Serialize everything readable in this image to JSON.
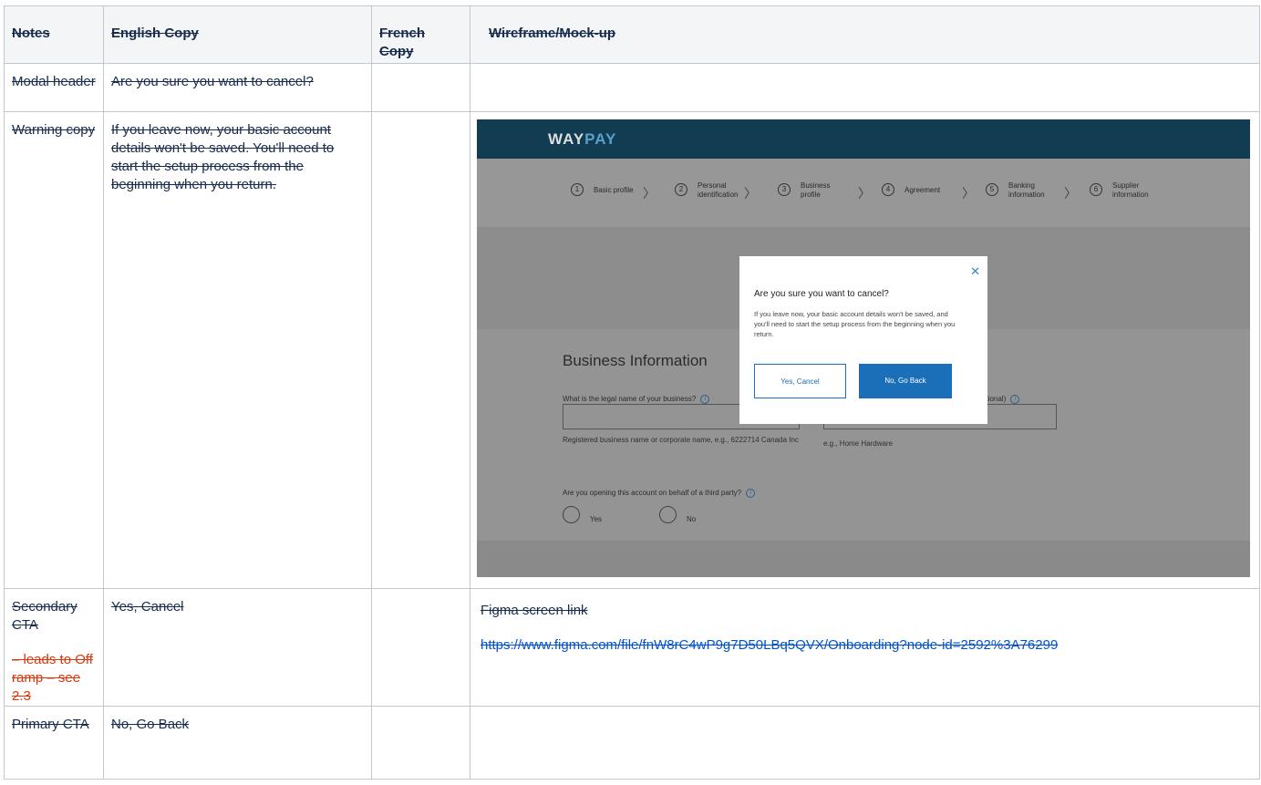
{
  "table": {
    "headers": {
      "notes": "Notes",
      "english": "English Copy",
      "french": "French Copy",
      "mock": "Wireframe/Mock-up"
    },
    "rows": [
      {
        "notes": "Modal header",
        "english": "Are you sure you want to cancel?",
        "french": ""
      },
      {
        "notes": "Warning copy",
        "english": "If you leave now, your basic account details won't be saved. You'll need to start the setup process from the beginning when you return.",
        "french": ""
      },
      {
        "notes": "Secondary CTA",
        "notes_extra": "– leads to Off ramp – see 2.3",
        "english": "Yes, Cancel",
        "french": "",
        "mock_label": "Figma screen link",
        "mock_link": "https://www.figma.com/file/fnW8rC4wP9g7D50LBq5QVX/Onboarding?node-id=2592%3A76299"
      },
      {
        "notes": "Primary CTA",
        "english": "No, Go Back",
        "french": ""
      }
    ]
  },
  "mockup": {
    "logo_way": "WAY",
    "logo_pay": "PAY",
    "steps": [
      {
        "num": "1",
        "label": "Basic profile"
      },
      {
        "num": "2",
        "label": "Personal identification"
      },
      {
        "num": "3",
        "label": "Business profile"
      },
      {
        "num": "4",
        "label": "Agreement"
      },
      {
        "num": "5",
        "label": "Banking information"
      },
      {
        "num": "6",
        "label": "Supplier information"
      }
    ],
    "form": {
      "title": "Business Information",
      "q1": "What is the legal name of your business?",
      "q2": "otional)",
      "help1": "Registered business name or corporate name,  e.g., 6222714 Canada Inc",
      "help2": "e.g., Home Hardware",
      "q3": "Are you opening this account on behalf of a third party?",
      "yes": "Yes",
      "no": "No",
      "info_glyph": "i"
    },
    "modal": {
      "close_glyph": "✕",
      "title": "Are you sure you want to cancel?",
      "body": "If you leave now, your basic account details won't be saved, and you'll need to start the setup process from the beginning when you return.",
      "secondary": "Yes, Cancel",
      "primary": "No, Go Back"
    }
  },
  "colors": {
    "link": "#0052cc",
    "red_note": "#de350b",
    "mock_header": "#123c52",
    "mock_button": "#1a6fb8"
  }
}
